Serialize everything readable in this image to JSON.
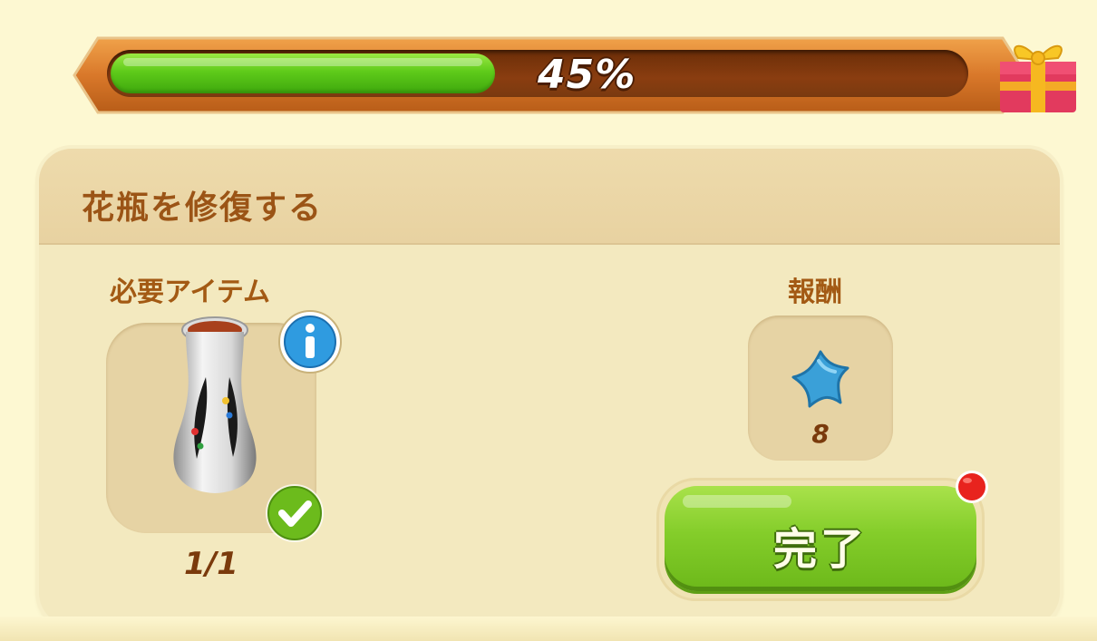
{
  "progress": {
    "percent_label": "45%",
    "value": 0.45,
    "fill_color": "#5fcb1a",
    "reward_icon": "gift-box-icon"
  },
  "task": {
    "title": "花瓶を修復する",
    "required_label": "必要アイテム",
    "reward_label": "報酬",
    "item": {
      "icon": "vase-icon",
      "count": "1/1",
      "info_icon": "info-icon",
      "status_icon": "checkmark-icon"
    },
    "reward": {
      "icon": "blue-star-icon",
      "count": "8"
    },
    "complete_button": {
      "label": "完了",
      "notification": "red-dot"
    }
  },
  "colors": {
    "background": "#fdf8d2",
    "panel": "#f3e9bf",
    "header_text": "#9b5416",
    "button_green": "#84cd2a",
    "frame_orange": "#d9782a"
  }
}
